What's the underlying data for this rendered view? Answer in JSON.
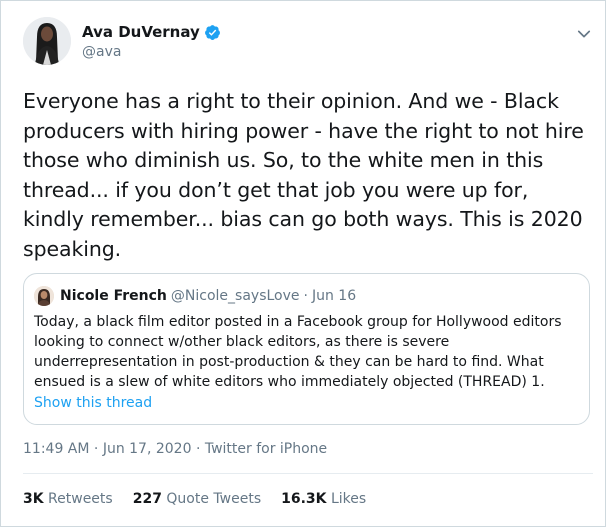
{
  "author": {
    "display_name": "Ava DuVernay",
    "handle": "@ava",
    "verified": true,
    "avatar_icon": "profile-photo"
  },
  "tweet": {
    "text": "Everyone has a right to their opinion. And we - Black producers with hiring power - have the right to not hire those who diminish us. So, to the white men in this thread... if you don’t get that job you were up for, kindly remember... bias can go both ways. This is 2020 speaking."
  },
  "quoted": {
    "display_name": "Nicole French",
    "handle": "@Nicole_saysLove",
    "separator": "·",
    "date": "Jun 16",
    "text": "Today, a black film editor posted in a Facebook group for Hollywood editors looking to connect w/other black editors, as there is severe underrepresentation in post-production & they can be hard to find.  What ensued is a slew of white editors who immediately objected (THREAD) 1.",
    "show_thread": "Show this thread"
  },
  "meta": {
    "time": "11:49 AM",
    "separator1": "·",
    "date": "Jun 17, 2020",
    "separator2": "·",
    "source": "Twitter for iPhone"
  },
  "stats": {
    "retweets_count": "3K",
    "retweets_label": "Retweets",
    "quotes_count": "227",
    "quotes_label": "Quote Tweets",
    "likes_count": "16.3K",
    "likes_label": "Likes"
  },
  "colors": {
    "link": "#1da1f2",
    "verified_badge": "#1da1f2",
    "secondary_text": "#657786"
  }
}
